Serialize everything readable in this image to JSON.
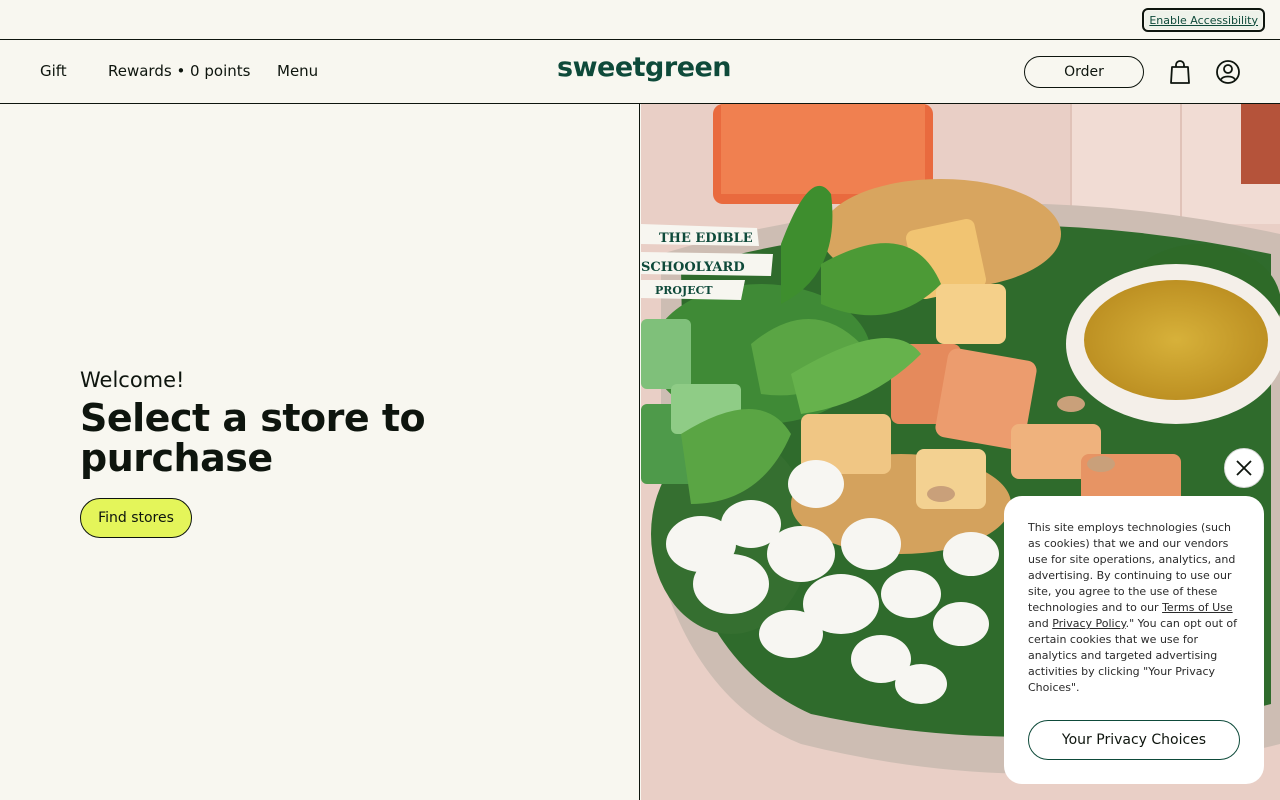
{
  "utility": {
    "accessibility_label": "Enable Accessibility"
  },
  "header": {
    "nav": {
      "gift": "Gift",
      "rewards": "Rewards • 0 points",
      "menu": "Menu"
    },
    "logo": "sweetgreen",
    "order_label": "Order",
    "icons": [
      "bag-icon",
      "account-icon"
    ]
  },
  "welcome": {
    "greeting": "Welcome!",
    "title": "Select a store to purchase",
    "find_stores_label": "Find stores"
  },
  "hero": {
    "badge_lines": [
      "THE EDIBLE",
      "SCHOOLYARD",
      "PROJECT"
    ]
  },
  "cookie": {
    "text_before_terms": "This site employs technologies (such as cookies) that we and our vendors use for site operations, analytics, and advertising. By continuing to use our site, you agree to the use of these technologies and to our ",
    "terms_link": "Terms of Use",
    "text_and": " and ",
    "privacy_link": "Privacy Policy",
    "text_after": ".\" You can opt out of certain cookies that we use for analytics and targeted advertising activities by clicking \"Your Privacy Choices\".",
    "button_label": "Your Privacy Choices",
    "close_icon": "close-icon"
  },
  "colors": {
    "background": "#f8f7f0",
    "brand_green": "#0e4a3a",
    "accent_lime": "#e4f55a",
    "text": "#0e150e"
  }
}
